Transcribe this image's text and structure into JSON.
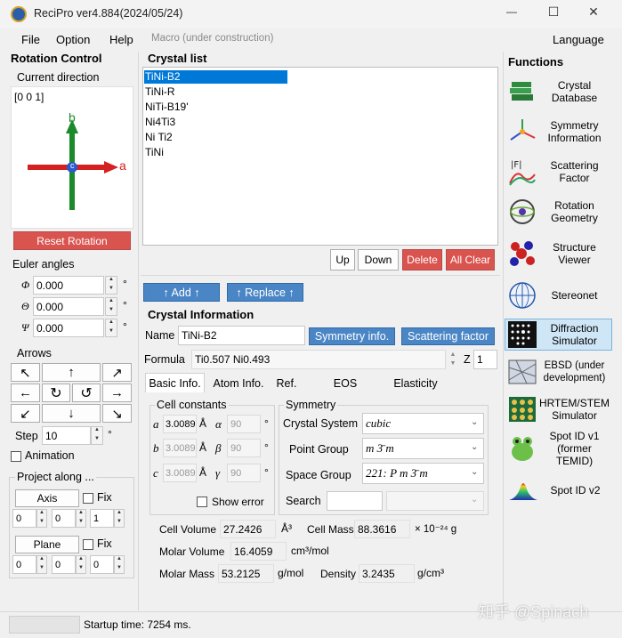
{
  "window": {
    "title": "ReciPro  ver4.884(2024/05/24)",
    "minimize_glyph": "—",
    "maximize_glyph": "☐",
    "close_glyph": "✕"
  },
  "menu": {
    "file": "File",
    "option": "Option",
    "help": "Help",
    "macro": "Macro (under construction)",
    "language": "Language"
  },
  "rotation": {
    "title": "Rotation Control",
    "current_direction_label": "Current direction",
    "current_direction": "[0 0 1]",
    "axis_b": "b",
    "axis_a": "a",
    "axis_c": "c",
    "reset": "Reset Rotation",
    "euler_label": "Euler angles",
    "euler": [
      {
        "sym": "Φ",
        "value": "0.000",
        "unit": "°"
      },
      {
        "sym": "Θ",
        "value": "0.000",
        "unit": "°"
      },
      {
        "sym": "Ψ",
        "value": "0.000",
        "unit": "°"
      }
    ],
    "arrows_label": "Arrows",
    "arrow_glyphs": [
      "↖",
      "↑",
      "↗",
      "←",
      "↻",
      "↺",
      "→",
      "↙",
      "↓",
      "↘"
    ],
    "step_label": "Step",
    "step_value": "10",
    "step_unit": "°",
    "animation": "Animation",
    "project_label": "Project along ...",
    "axis_btn": "Axis",
    "fix": "Fix",
    "plane_btn": "Plane",
    "axis_values": [
      "0",
      "0",
      "1"
    ],
    "plane_values": [
      "0",
      "0",
      "0"
    ]
  },
  "crystal_list": {
    "title": "Crystal list",
    "items": [
      "TiNi-B2",
      "TiNi-R",
      "NiTi-B19'",
      "Ni4Ti3",
      "Ni Ti2",
      "TiNi"
    ],
    "selected_index": 0,
    "up": "Up",
    "down": "Down",
    "delete": "Delete",
    "all_clear": "All Clear",
    "add": "↑ Add ↑",
    "replace": "↑ Replace ↑"
  },
  "crystal_info": {
    "title": "Crystal Information",
    "name_label": "Name",
    "name": "TiNi-B2",
    "symmetry_btn": "Symmetry info.",
    "scattering_btn": "Scattering factor",
    "formula_label": "Formula",
    "formula": "Ti0.507 Ni0.493",
    "z_label": "Z",
    "z": "1",
    "tabs": [
      "Basic Info.",
      "Atom Info.",
      "Ref.",
      "EOS",
      "Elasticity"
    ],
    "active_tab": 0,
    "cell_constants_label": "Cell constants",
    "cell": [
      {
        "sym": "a",
        "value": "3.0089",
        "unit": "Å",
        "angle_sym": "α",
        "angle": "90",
        "aunit": "°"
      },
      {
        "sym": "b",
        "value": "3.0089",
        "unit": "Å",
        "angle_sym": "β",
        "angle": "90",
        "aunit": "°"
      },
      {
        "sym": "c",
        "value": "3.0089",
        "unit": "Å",
        "angle_sym": "γ",
        "angle": "90",
        "aunit": "°"
      }
    ],
    "show_error": "Show error",
    "symmetry_label": "Symmetry",
    "crystal_system_label": "Crystal System",
    "crystal_system": "cubic",
    "point_group_label": "Point Group",
    "point_group": "m 3̄ m",
    "space_group_label": "Space Group",
    "space_group": "221:  P m 3̄ m",
    "search_label": "Search",
    "cell_volume_label": "Cell Volume",
    "cell_volume": "27.2426",
    "cell_volume_unit": "Å³",
    "cell_mass_label": "Cell Mass",
    "cell_mass": "88.3616",
    "cell_mass_unit": "× 10⁻²⁴ g",
    "molar_volume_label": "Molar Volume",
    "molar_volume": "16.4059",
    "molar_volume_unit": "cm³/mol",
    "molar_mass_label": "Molar Mass",
    "molar_mass": "53.2125",
    "molar_mass_unit": "g/mol",
    "density_label": "Density",
    "density": "3.2435",
    "density_unit": "g/cm³"
  },
  "functions": {
    "title": "Functions",
    "items": [
      {
        "label": "Crystal Database",
        "icon": "database-icon"
      },
      {
        "label": "Symmetry Information",
        "icon": "symmetry-icon"
      },
      {
        "label": "Scattering Factor",
        "icon": "scattering-icon"
      },
      {
        "label": "Rotation Geometry",
        "icon": "rotation-geometry-icon"
      },
      {
        "label": "Structure Viewer",
        "icon": "structure-icon"
      },
      {
        "label": "Stereonet",
        "icon": "stereonet-icon"
      },
      {
        "label": "Diffraction Simulator",
        "icon": "diffraction-icon"
      },
      {
        "label": "EBSD (under development)",
        "icon": "ebsd-icon"
      },
      {
        "label": "HRTEM/STEM Simulator",
        "icon": "hrtem-icon"
      },
      {
        "label": "Spot ID v1 (former TEMID)",
        "icon": "spot-id-v1-icon"
      },
      {
        "label": "Spot ID v2",
        "icon": "spot-id-v2-icon"
      }
    ]
  },
  "status": {
    "startup": "Startup time: 7254 ms."
  },
  "watermark": "知乎 @Spinach",
  "colors": {
    "selection": "#0078d7",
    "red_button": "#d9534f",
    "blue_button": "#4a86c5",
    "active_function": "#cfe6f7"
  }
}
